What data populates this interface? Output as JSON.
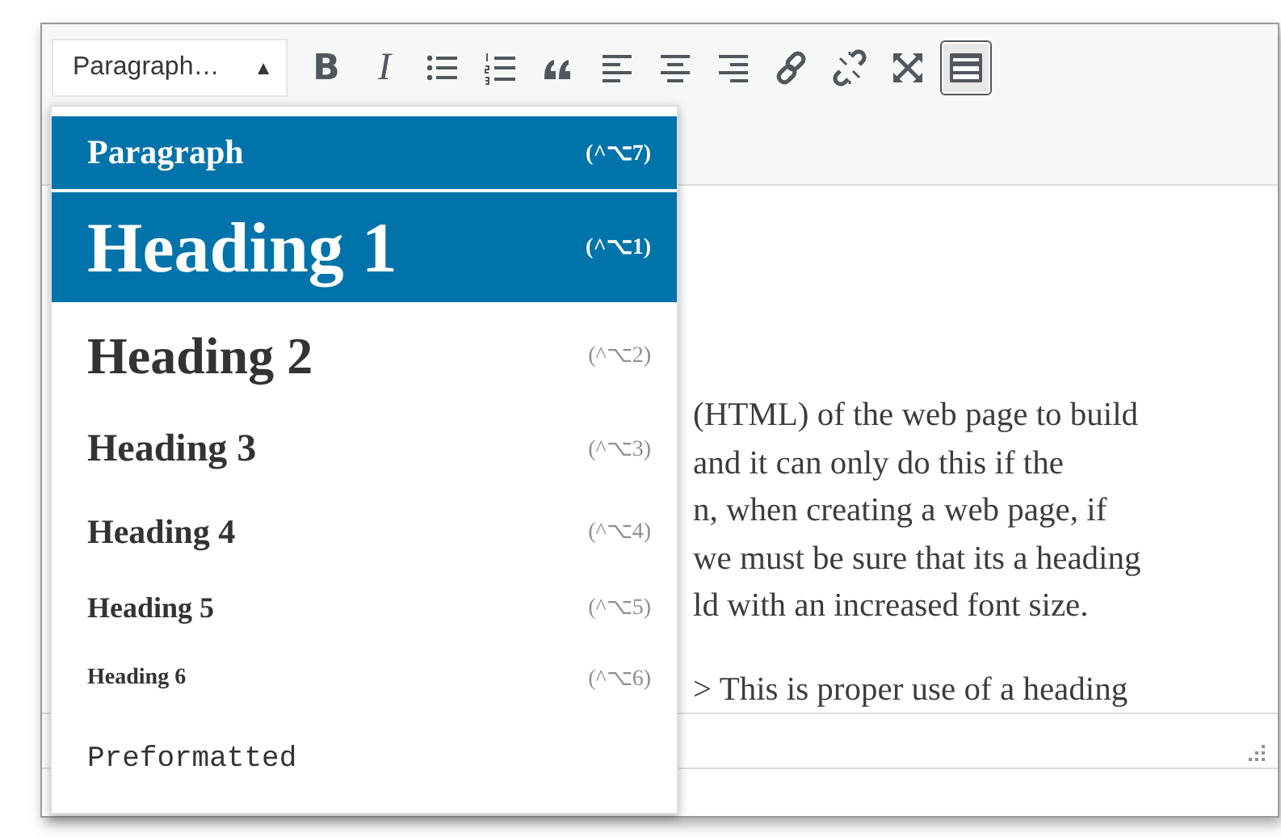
{
  "toolbar": {
    "format_select": {
      "value": "Paragraph…",
      "arrow": "▲"
    },
    "buttons": [
      {
        "kind": "bold",
        "label": "B",
        "pressed": false
      },
      {
        "kind": "italic",
        "label": "I",
        "pressed": false
      },
      {
        "kind": "bullet-list",
        "pressed": false
      },
      {
        "kind": "numbered-list",
        "pressed": false
      },
      {
        "kind": "quote",
        "pressed": false
      },
      {
        "kind": "align-left",
        "pressed": false
      },
      {
        "kind": "align-center",
        "pressed": false
      },
      {
        "kind": "align-right",
        "pressed": false
      },
      {
        "kind": "link",
        "pressed": false
      },
      {
        "kind": "unlink",
        "pressed": false
      },
      {
        "kind": "fullscreen",
        "pressed": false
      },
      {
        "kind": "toolbar-toggle",
        "pressed": true
      }
    ]
  },
  "format_menu": [
    {
      "kind": "paragraph",
      "label": "Paragraph",
      "shortcut": "(^⌥7)",
      "selected": true
    },
    {
      "kind": "h1",
      "label": "Heading 1",
      "shortcut": "(^⌥1)",
      "selected": true
    },
    {
      "kind": "h2",
      "label": "Heading 2",
      "shortcut": "(^⌥2)",
      "selected": false
    },
    {
      "kind": "h3",
      "label": "Heading 3",
      "shortcut": "(^⌥3)",
      "selected": false
    },
    {
      "kind": "h4",
      "label": "Heading 4",
      "shortcut": "(^⌥4)",
      "selected": false
    },
    {
      "kind": "h5",
      "label": "Heading 5",
      "shortcut": "(^⌥5)",
      "selected": false
    },
    {
      "kind": "h6",
      "label": "Heading 6",
      "shortcut": "(^⌥6)",
      "selected": false
    },
    {
      "kind": "pre",
      "label": "Preformatted",
      "selected": false
    }
  ],
  "editor": {
    "lines": [
      "(HTML) of the web page to build",
      "and it can only do this if the",
      "n, when creating a web page, if",
      "we must be sure that its a heading",
      "ld with an increased font size."
    ],
    "last_line": "> This is proper use of a heading"
  }
}
